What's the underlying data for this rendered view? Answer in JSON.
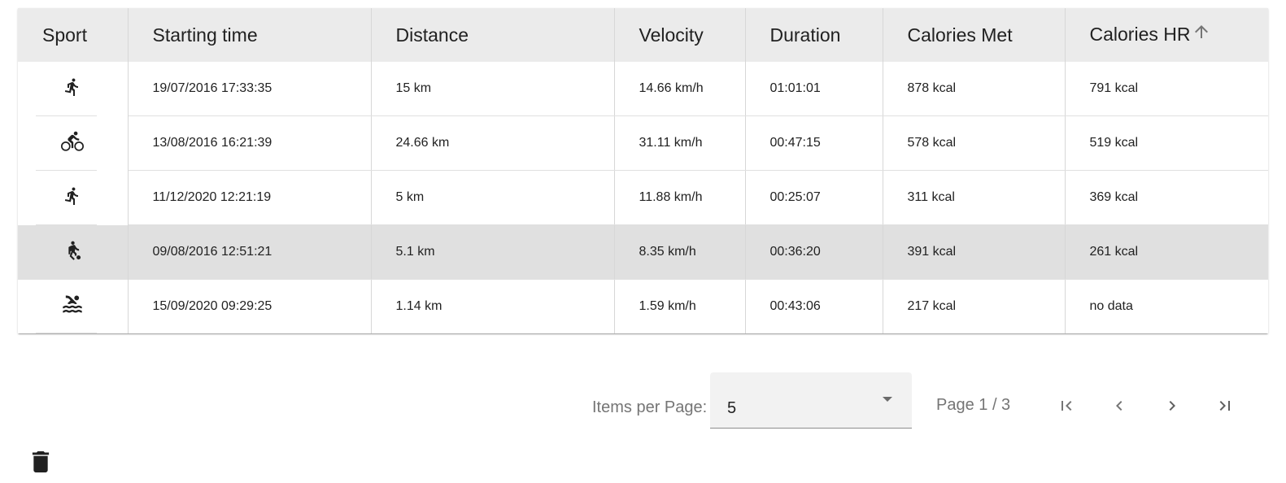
{
  "table": {
    "headers": {
      "sport": "Sport",
      "starting_time": "Starting time",
      "distance": "Distance",
      "velocity": "Velocity",
      "duration": "Duration",
      "calories_met": "Calories Met",
      "calories_hr": "Calories HR"
    },
    "sort": {
      "column": "calories_hr",
      "icon": "arrow-up-icon"
    },
    "rows": [
      {
        "sport_icon": "running-icon",
        "starting_time": "19/07/2016 17:33:35",
        "distance": "15 km",
        "velocity": "14.66 km/h",
        "duration": "01:01:01",
        "calories_met": "878 kcal",
        "calories_hr": "791 kcal"
      },
      {
        "sport_icon": "cycling-icon",
        "starting_time": "13/08/2016 16:21:39",
        "distance": "24.66 km",
        "velocity": "31.11 km/h",
        "duration": "00:47:15",
        "calories_met": "578 kcal",
        "calories_hr": "519 kcal"
      },
      {
        "sport_icon": "running-icon",
        "starting_time": "11/12/2020 12:21:19",
        "distance": "5 km",
        "velocity": "11.88 km/h",
        "duration": "00:25:07",
        "calories_met": "311 kcal",
        "calories_hr": "369 kcal"
      },
      {
        "sport_icon": "soccer-icon",
        "starting_time": "09/08/2016 12:51:21",
        "distance": "5.1 km",
        "velocity": "8.35 km/h",
        "duration": "00:36:20",
        "calories_met": "391 kcal",
        "calories_hr": "261 kcal",
        "selected": true
      },
      {
        "sport_icon": "swimming-icon",
        "starting_time": "15/09/2020 09:29:25",
        "distance": "1.14 km",
        "velocity": "1.59 km/h",
        "duration": "00:43:06",
        "calories_met": "217 kcal",
        "calories_hr": "no data"
      }
    ]
  },
  "pagination": {
    "items_per_page_label": "Items per Page:",
    "items_per_page_value": "5",
    "page_info": "Page 1 / 3",
    "buttons": [
      "first-page-icon",
      "previous-page-icon",
      "next-page-icon",
      "last-page-icon"
    ]
  },
  "actions": {
    "delete_icon": "trash-icon"
  },
  "colors": {
    "header_bg": "#ebebeb",
    "selected_row_bg": "#e0e0e0",
    "icon": "#212121",
    "muted_text": "#757575"
  }
}
